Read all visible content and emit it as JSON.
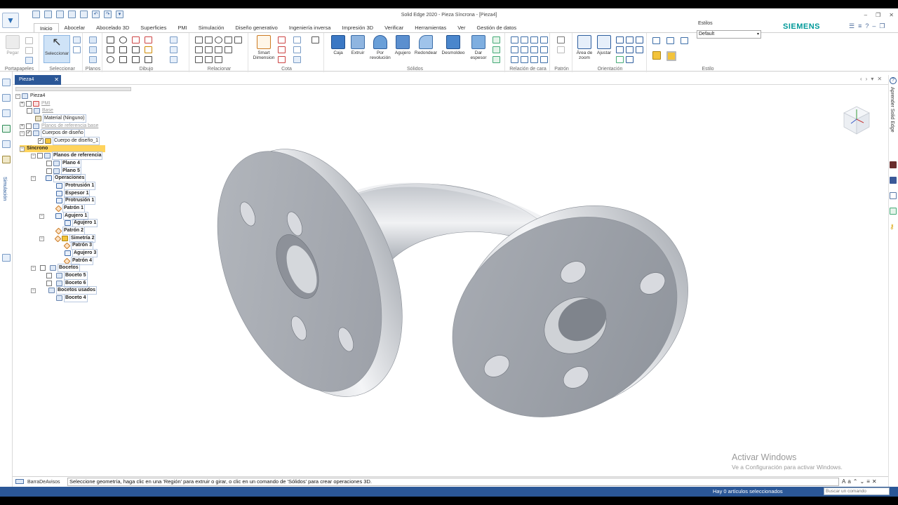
{
  "window": {
    "title": "Solid Edge 2020 - Pieza Síncrona - [Pieza4]",
    "brand": "SIEMENS",
    "brand_color": "#009999",
    "accent_color": "#2b5797"
  },
  "tabs": [
    "Inicio",
    "Abocelar",
    "Abocelado 3D",
    "Superficies",
    "PMI",
    "Simulación",
    "Diseño generativo",
    "Ingeniería inversa",
    "Impresión 3D",
    "Verificar",
    "Herramientas",
    "Ver",
    "Gestión de datos"
  ],
  "ribbon": {
    "groups": {
      "portapapeles": "Portapapeles",
      "seleccionar": "Seleccionar",
      "planos": "Planos",
      "dibujo": "Dibujo",
      "relacionar": "Relacionar",
      "cota": "Cota",
      "solidos": "Sólidos",
      "relacion_cara": "Relación de cara",
      "patron": "Patrón",
      "orientacion": "Orientación",
      "estilo": "Estilo"
    },
    "buttons": {
      "pegar": "Pegar",
      "seleccionar": "Seleccionar",
      "smart_dimension": "Smart Dimension",
      "caja": "Caja",
      "extruir": "Extruir",
      "por_revolucion": "Por revolución",
      "agujero": "Agujero",
      "redondear": "Redondear",
      "desmoldeo": "Desmoldeo",
      "dar_espesor": "Dar espesor",
      "area_zoom": "Área de zoom",
      "ajustar": "Ajustar"
    },
    "estilos_label": "Estilos",
    "style_value": "Default"
  },
  "document_tab": "Pieza4",
  "left_strip_label": "Simulación",
  "right_strip_label": "Aprender Solid Edge",
  "tree": [
    {
      "label": "Pieza4",
      "style": "box"
    },
    {
      "label": "PMI",
      "style": "grey"
    },
    {
      "label": "Base",
      "style": "grey"
    },
    {
      "label": "Material (Ninguno)",
      "style": "box"
    },
    {
      "label": "Planos de referencia base",
      "style": "grey"
    },
    {
      "label": "Cuerpos de diseño",
      "style": "box"
    },
    {
      "label": "Cuerpo de diseño_1",
      "style": "box"
    },
    {
      "label": "Síncrono",
      "style": "bold"
    },
    {
      "label": "Planos de referencia",
      "style": "bold"
    },
    {
      "label": "Plano 4",
      "style": "bold"
    },
    {
      "label": "Plano 5",
      "style": "bold"
    },
    {
      "label": "Operaciones",
      "style": "bold"
    },
    {
      "label": "Protrusión 1",
      "style": "bold"
    },
    {
      "label": "Espesor 1",
      "style": "bold"
    },
    {
      "label": "Protrusión 1",
      "style": "bold"
    },
    {
      "label": "Patrón 1",
      "style": "bold"
    },
    {
      "label": "Agujero 1",
      "style": "bold"
    },
    {
      "label": "Agujero 1",
      "style": "bold"
    },
    {
      "label": "Patrón 2",
      "style": "bold"
    },
    {
      "label": "Simetría 2",
      "style": "bold"
    },
    {
      "label": "Patrón 3",
      "style": "bold"
    },
    {
      "label": "Agujero 3",
      "style": "bold"
    },
    {
      "label": "Patrón 4",
      "style": "bold"
    },
    {
      "label": "Bocetos",
      "style": "bold"
    },
    {
      "label": "Boceto 5",
      "style": "bold"
    },
    {
      "label": "Boceto 6",
      "style": "bold"
    },
    {
      "label": "Bocetos usados",
      "style": "bold"
    },
    {
      "label": "Boceto 4",
      "style": "bold"
    }
  ],
  "watermark": {
    "line1": "Activar Windows",
    "line2": "Ve a Configuración para activar Windows."
  },
  "prompt_bar": {
    "label": "BarraDeAvisos",
    "text": "Seleccione geometría, haga clic en una 'Región' para extruir o girar, o clic en un comando de 'Sólidos' para crear operaciones 3D."
  },
  "status": {
    "text": "Hay 0 artículos seleccionados",
    "search_placeholder": "Buscar un comando"
  }
}
